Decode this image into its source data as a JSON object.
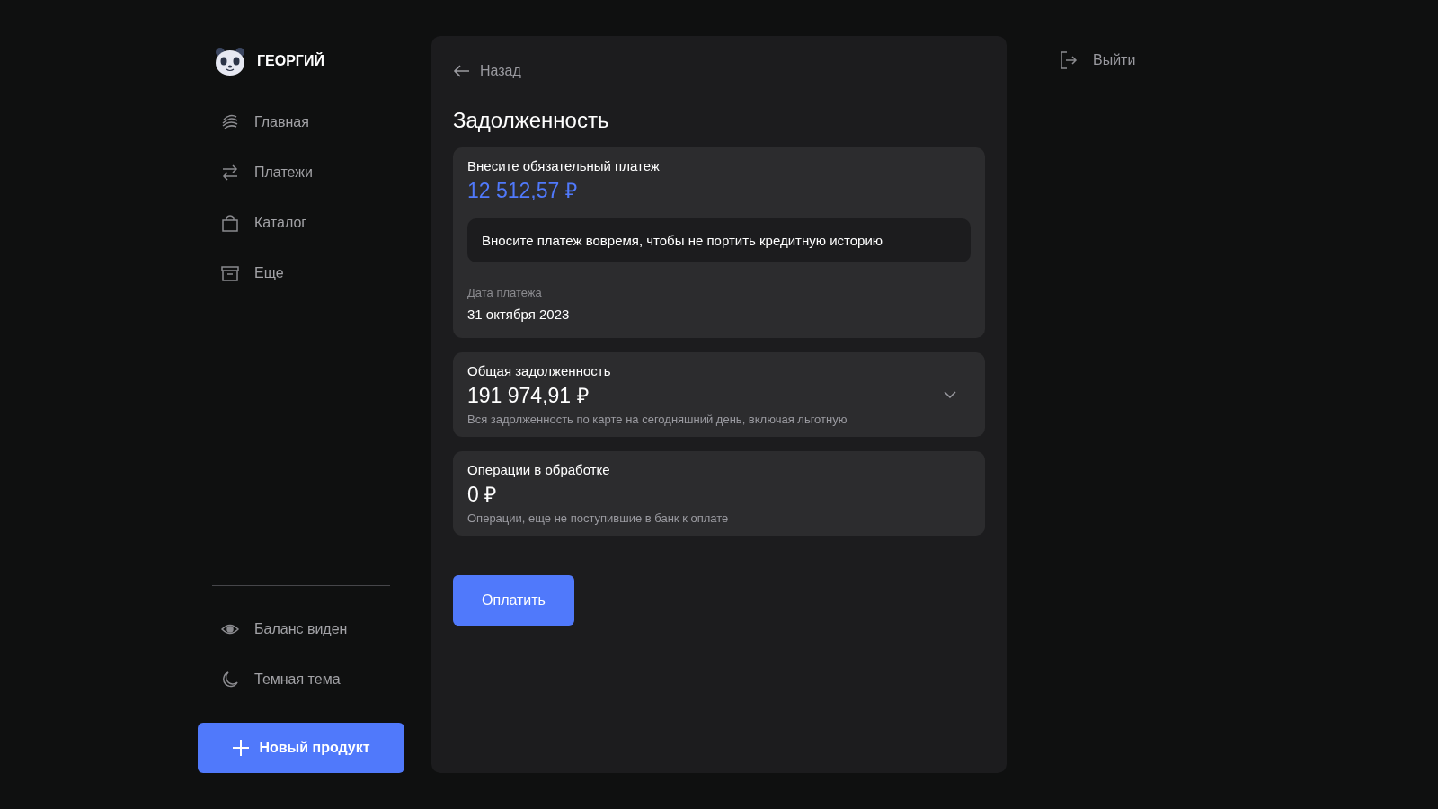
{
  "user": {
    "name": "ГЕОРГИЙ"
  },
  "nav": [
    {
      "kind": "home",
      "label": "Главная"
    },
    {
      "kind": "transfer",
      "label": "Платежи"
    },
    {
      "kind": "bag",
      "label": "Каталог"
    },
    {
      "kind": "box",
      "label": "Еще"
    }
  ],
  "settings": [
    {
      "kind": "eye",
      "label": "Баланс виден"
    },
    {
      "kind": "moon",
      "label": "Темная тема"
    }
  ],
  "new_product_button": "Новый продукт",
  "back": "Назад",
  "title": "Задолженность",
  "payment_card": {
    "label": "Внесите обязательный платеж",
    "amount": "12 512,57 ₽",
    "notice": "Вносите платеж вовремя, чтобы не портить кредитную историю",
    "date_label": "Дата платежа",
    "date": "31 октября 2023"
  },
  "sections": [
    {
      "label": "Общая задолженность",
      "amount": "191 974,91 ₽",
      "note": "Вся задолженность по карте на сегодняшний день, включая льготную",
      "expanded": false
    },
    {
      "label": "Операции в обработке",
      "amount": "0 ₽",
      "note": "Операции, еще не поступившие в банк к оплате"
    }
  ],
  "pay_button": "Оплатить",
  "logout": "Выйти"
}
